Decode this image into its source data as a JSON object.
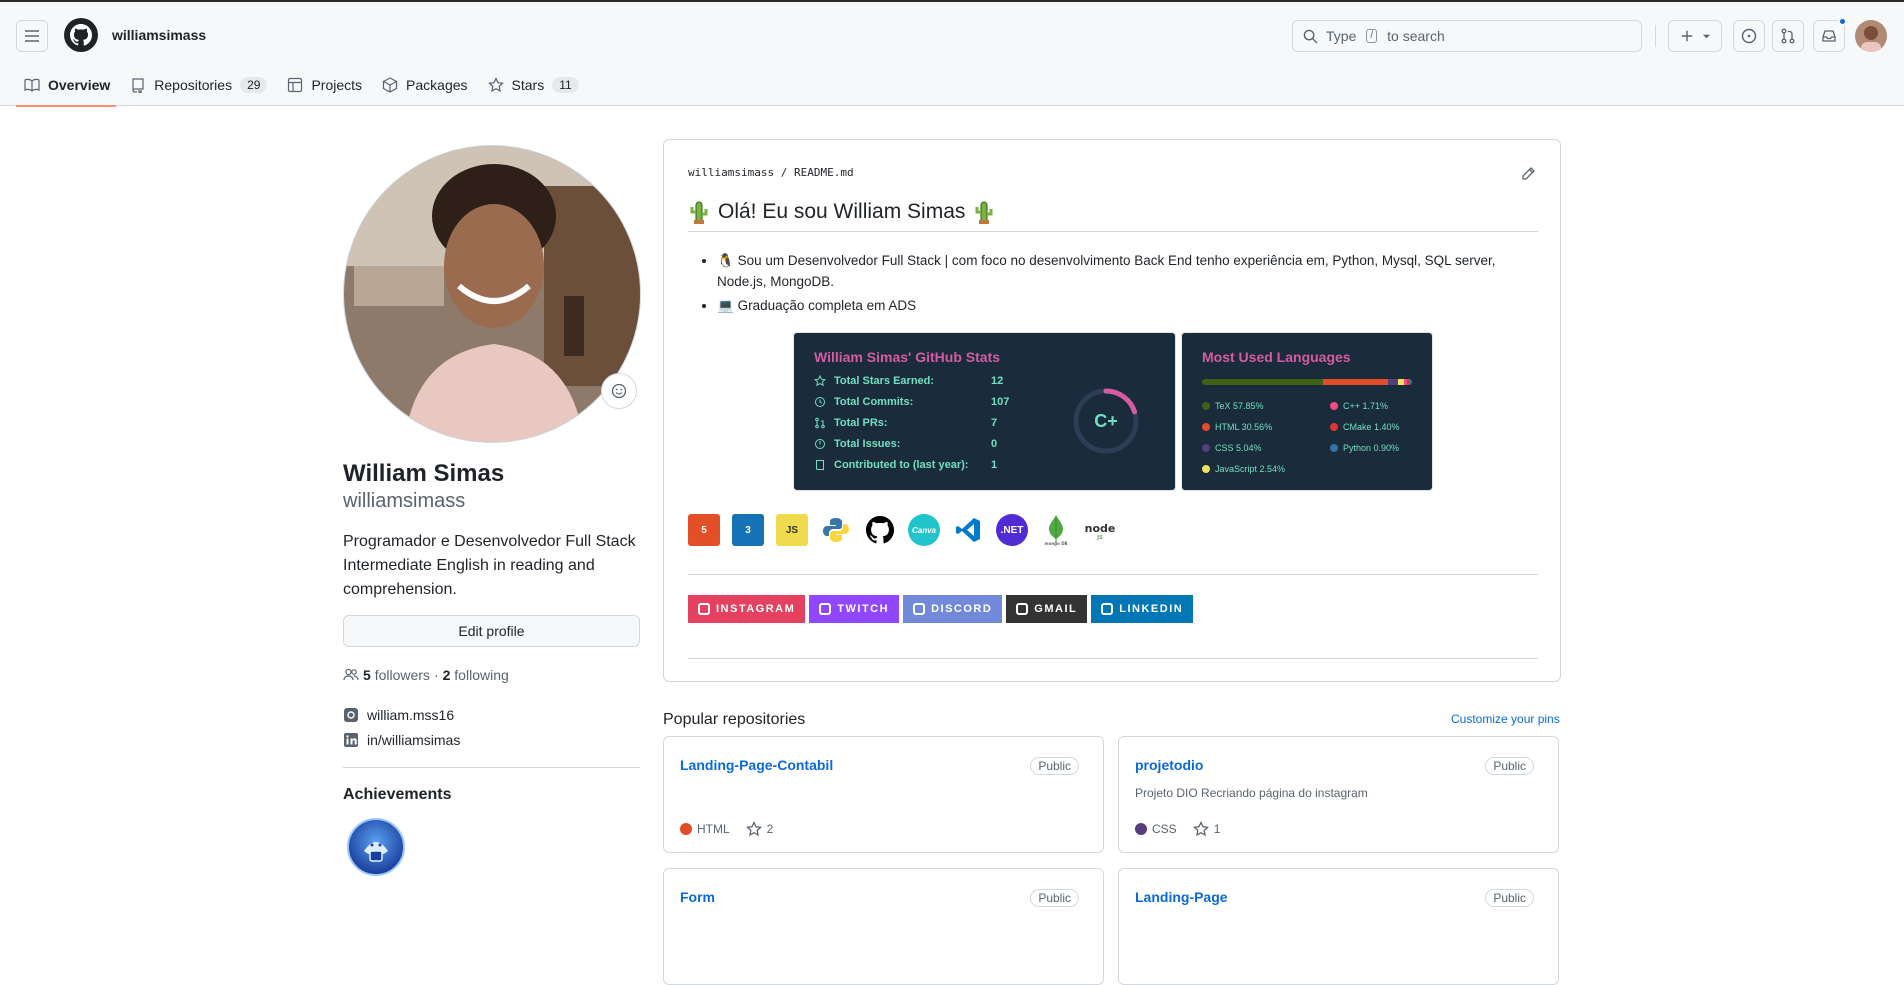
{
  "header": {
    "username": "williamsimass",
    "search_placeholder_pre": "Type",
    "search_key": "/",
    "search_placeholder_post": "to search"
  },
  "tabs": [
    {
      "label": "Overview"
    },
    {
      "label": "Repositories",
      "count": "29"
    },
    {
      "label": "Projects"
    },
    {
      "label": "Packages"
    },
    {
      "label": "Stars",
      "count": "11"
    }
  ],
  "profile": {
    "name": "William Simas",
    "login": "williamsimass",
    "bio_line1": "Programador e Desenvolvedor Full Stack",
    "bio_line2": "Intermediate English in reading and comprehension.",
    "edit_label": "Edit profile",
    "followers_count": "5",
    "followers_label": "followers",
    "following_count": "2",
    "following_label": "following",
    "dot_sep": "·",
    "instagram": "william.mss16",
    "linkedin": "in/williamsimas",
    "achievements_title": "Achievements"
  },
  "readme": {
    "path_user": "williamsimass",
    "path_sep": "/",
    "path_file": "README.md",
    "title": "Olá! Eu sou William Simas",
    "bullet1": "Sou um Desenvolvedor Full Stack | com foco no desenvolvimento Back End tenho experiência em, Python, Mysql, SQL server, Node.js, MongoDB.",
    "bullet2": "Graduação completa em ADS",
    "stats": {
      "title": "William Simas' GitHub Stats",
      "rows": [
        {
          "label": "Total Stars Earned:",
          "value": "12"
        },
        {
          "label": "Total Commits:",
          "value": "107"
        },
        {
          "label": "Total PRs:",
          "value": "7"
        },
        {
          "label": "Total Issues:",
          "value": "0"
        },
        {
          "label": "Contributed to (last year):",
          "value": "1"
        }
      ],
      "grade": "C+",
      "grade_progress": 0.2
    },
    "langs": {
      "title": "Most Used Languages",
      "items": [
        {
          "name": "TeX 57.85%",
          "color": "#3d6117",
          "pct": 57.85
        },
        {
          "name": "HTML 30.56%",
          "color": "#e34c26",
          "pct": 30.56
        },
        {
          "name": "CSS 5.04%",
          "color": "#563d7c",
          "pct": 5.04
        },
        {
          "name": "JavaScript 2.54%",
          "color": "#f1e05a",
          "pct": 2.54
        },
        {
          "name": "C++ 1.71%",
          "color": "#f34b7d",
          "pct": 1.71
        },
        {
          "name": "CMake 1.40%",
          "color": "#da3434",
          "pct": 1.4
        },
        {
          "name": "Python 0.90%",
          "color": "#3572a5",
          "pct": 0.9
        }
      ]
    },
    "tech_icons": [
      {
        "name": "html5-icon",
        "text": "5",
        "bg": "#e34f26"
      },
      {
        "name": "css3-icon",
        "text": "3",
        "bg": "#1572b6"
      },
      {
        "name": "javascript-icon",
        "text": "JS",
        "bg": "#f0db4f"
      },
      {
        "name": "python-icon",
        "text": "",
        "bg": "#ffffff"
      },
      {
        "name": "github-icon",
        "text": "",
        "bg": "#ffffff"
      },
      {
        "name": "canva-icon",
        "text": "Canva",
        "bg": "#20c4cb"
      },
      {
        "name": "vscode-icon",
        "text": "",
        "bg": "#ffffff"
      },
      {
        "name": "dotnet-icon",
        "text": ".NET",
        "bg": "#512bd4"
      },
      {
        "name": "mongodb-icon",
        "text": "",
        "bg": "#ffffff"
      },
      {
        "name": "nodejs-icon",
        "text": "node",
        "bg": "#ffffff"
      }
    ],
    "shields": [
      {
        "label": "INSTAGRAM",
        "bg": "#e4405f",
        "icon": "instagram-icon"
      },
      {
        "label": "TWITCH",
        "bg": "#9146ff",
        "icon": "twitch-icon"
      },
      {
        "label": "DISCORD",
        "bg": "#7289da",
        "icon": "discord-icon"
      },
      {
        "label": "GMAIL",
        "bg": "#333333",
        "icon": "gmail-icon"
      },
      {
        "label": "LINKEDIN",
        "bg": "#0077b5",
        "icon": "linkedin-icon"
      }
    ]
  },
  "popular": {
    "title": "Popular repositories",
    "customize": "Customize your pins",
    "repos": [
      {
        "name": "Landing-Page-Contabil",
        "visibility": "Public",
        "desc": "",
        "lang": "HTML",
        "lang_color": "#e34c26",
        "stars": "2"
      },
      {
        "name": "projetodio",
        "visibility": "Public",
        "desc": "Projeto DIO Recriando página do instagram",
        "lang": "CSS",
        "lang_color": "#563d7c",
        "stars": "1"
      },
      {
        "name": "Form",
        "visibility": "Public",
        "desc": "",
        "lang": "",
        "lang_color": "",
        "stars": ""
      },
      {
        "name": "Landing-Page",
        "visibility": "Public",
        "desc": "",
        "lang": "",
        "lang_color": "",
        "stars": ""
      }
    ]
  },
  "colors": {
    "accent": "#0969da",
    "tab_underline": "#fd8c73",
    "card_bg": "#1a2b3c",
    "card_title": "#d55ba3",
    "card_text": "#72e0c0"
  }
}
